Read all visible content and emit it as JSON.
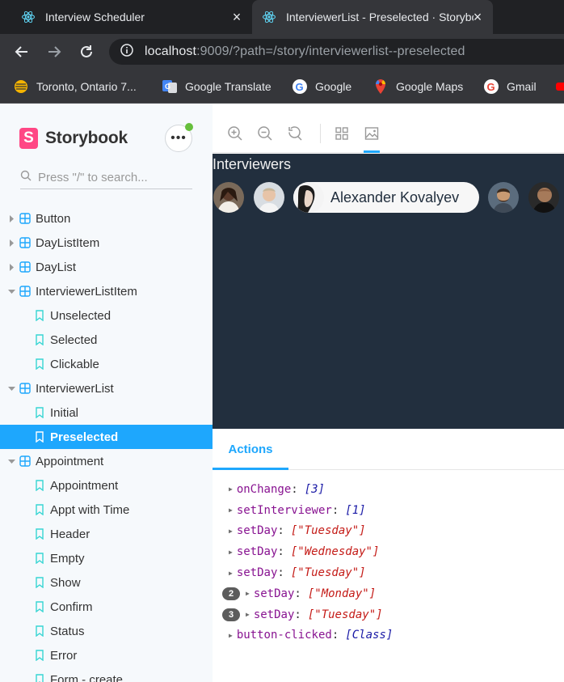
{
  "browser": {
    "tabs": [
      {
        "title": "Interview Scheduler",
        "active": false
      },
      {
        "title": "InterviewerList - Preselected · Storybook",
        "active": true
      }
    ],
    "address": {
      "host": "localhost",
      "rest": ":9009/?path=/story/interviewerlist--preselected"
    },
    "bookmarks": [
      {
        "label": "Toronto, Ontario 7...",
        "icon": "weather-icon"
      },
      {
        "label": "Google Translate",
        "icon": "google-translate-icon"
      },
      {
        "label": "Google",
        "icon": "google-icon"
      },
      {
        "label": "Google Maps",
        "icon": "google-maps-icon"
      },
      {
        "label": "Gmail",
        "icon": "gmail-icon"
      }
    ]
  },
  "sidebar": {
    "brand": "Storybook",
    "brand_letter": "S",
    "search_placeholder": "Press \"/\" to search...",
    "tree": [
      {
        "label": "Button",
        "type": "component",
        "expanded": false
      },
      {
        "label": "DayListItem",
        "type": "component",
        "expanded": false
      },
      {
        "label": "DayList",
        "type": "component",
        "expanded": false
      },
      {
        "label": "InterviewerListItem",
        "type": "component",
        "expanded": true
      },
      {
        "label": "Unselected",
        "type": "story"
      },
      {
        "label": "Selected",
        "type": "story"
      },
      {
        "label": "Clickable",
        "type": "story"
      },
      {
        "label": "InterviewerList",
        "type": "component",
        "expanded": true
      },
      {
        "label": "Initial",
        "type": "story"
      },
      {
        "label": "Preselected",
        "type": "story",
        "selected": true
      },
      {
        "label": "Appointment",
        "type": "component",
        "expanded": true
      },
      {
        "label": "Appointment",
        "type": "story"
      },
      {
        "label": "Appt with Time",
        "type": "story"
      },
      {
        "label": "Header",
        "type": "story"
      },
      {
        "label": "Empty",
        "type": "story"
      },
      {
        "label": "Show",
        "type": "story"
      },
      {
        "label": "Confirm",
        "type": "story"
      },
      {
        "label": "Status",
        "type": "story"
      },
      {
        "label": "Error",
        "type": "story"
      },
      {
        "label": "Form - create",
        "type": "story"
      }
    ]
  },
  "preview": {
    "title": "Interviewers",
    "selected_interviewer": "Alexander Kovalyev"
  },
  "panel": {
    "tab": "Actions",
    "log": [
      {
        "key": "onChange",
        "value": "[3]",
        "count": null
      },
      {
        "key": "setInterviewer",
        "value": "[1]",
        "count": null
      },
      {
        "key": "setDay",
        "value": "[\"Tuesday\"]",
        "count": null
      },
      {
        "key": "setDay",
        "value": "[\"Wednesday\"]",
        "count": null
      },
      {
        "key": "setDay",
        "value": "[\"Tuesday\"]",
        "count": null
      },
      {
        "key": "setDay",
        "value": "[\"Monday\"]",
        "count": "2"
      },
      {
        "key": "setDay",
        "value": "[\"Tuesday\"]",
        "count": "3"
      },
      {
        "key": "button-clicked",
        "value": "[Class]",
        "count": null
      }
    ]
  },
  "colors": {
    "accent": "#1ea7fd",
    "preview_bg": "#222f3e",
    "storybook_pink": "#ff4785"
  }
}
